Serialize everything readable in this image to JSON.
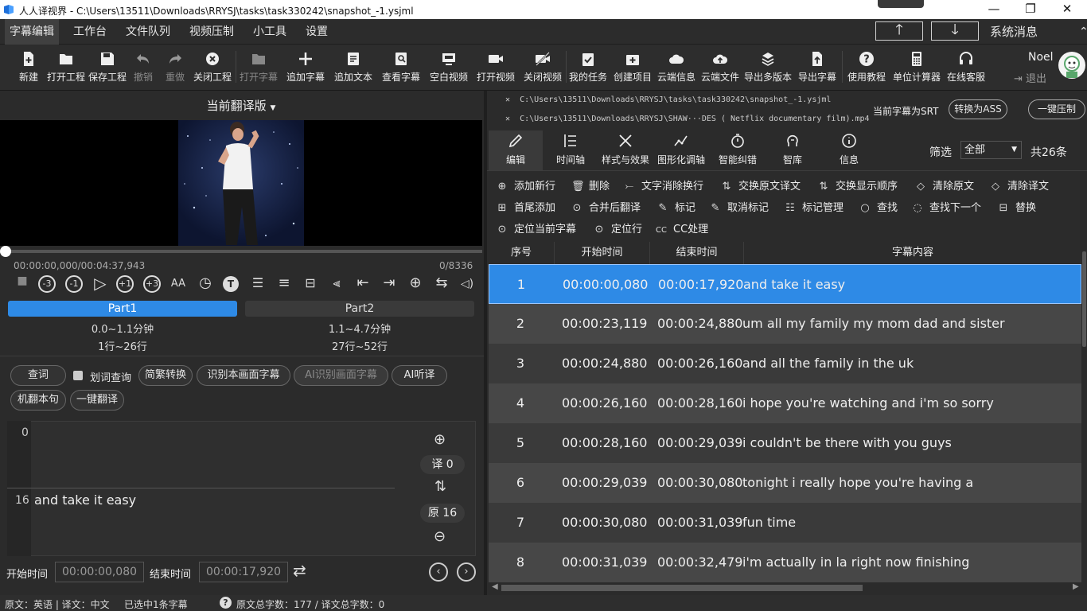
{
  "window": {
    "title": "人人译视界 - C:\\Users\\13511\\Downloads\\RRYSJ\\tasks\\task330242\\snapshot_-1.ysjml",
    "minimize_glyph": "—",
    "maximize_glyph": "❐",
    "close_glyph": "✕"
  },
  "menubar": {
    "items": [
      "字幕编辑",
      "工作台",
      "文件队列",
      "视频压制",
      "小工具",
      "设置"
    ],
    "up_glyph": "🡑",
    "down_glyph": "🡓",
    "system_messages": "系统消息"
  },
  "toolbar": {
    "items": [
      {
        "label": "新建",
        "icon": "new-file-icon"
      },
      {
        "label": "打开工程",
        "icon": "folder-open-icon"
      },
      {
        "label": "保存工程",
        "icon": "save-icon"
      },
      {
        "label": "撤销",
        "icon": "undo-icon"
      },
      {
        "label": "重做",
        "icon": "redo-icon"
      },
      {
        "label": "关闭工程",
        "icon": "close-circle-icon"
      },
      {
        "label": "打开字幕",
        "icon": "folder-icon"
      },
      {
        "label": "追加字幕",
        "icon": "plus-icon"
      },
      {
        "label": "追加文本",
        "icon": "text-doc-icon"
      },
      {
        "label": "查看字幕",
        "icon": "view-subtitle-icon"
      },
      {
        "label": "空白视频",
        "icon": "blank-video-icon"
      },
      {
        "label": "打开视频",
        "icon": "video-camera-icon"
      },
      {
        "label": "关闭视频",
        "icon": "video-off-icon"
      },
      {
        "label": "我的任务",
        "icon": "clipboard-check-icon"
      },
      {
        "label": "创建项目",
        "icon": "create-project-icon"
      },
      {
        "label": "云端信息",
        "icon": "cloud-icon"
      },
      {
        "label": "云端文件",
        "icon": "cloud-upload-icon"
      },
      {
        "label": "导出多版本",
        "icon": "layers-export-icon"
      },
      {
        "label": "导出字幕",
        "icon": "export-file-icon"
      },
      {
        "label": "使用教程",
        "icon": "help-icon"
      },
      {
        "label": "单位计算器",
        "icon": "calculator-icon"
      },
      {
        "label": "在线客服",
        "icon": "headset-icon"
      }
    ],
    "user_name": "Noel",
    "logout": "退出"
  },
  "left": {
    "version_select": "当前翻译版",
    "time_readout": "00:00:00,000/00:04:37,943",
    "frame_counter": "0/8336",
    "controls": [
      {
        "name": "stop-icon",
        "glyph": "■"
      },
      {
        "name": "rewind-3-icon",
        "glyph": "-3"
      },
      {
        "name": "rewind-1-icon",
        "glyph": "-1"
      },
      {
        "name": "play-icon",
        "glyph": "▷"
      },
      {
        "name": "forward-1-icon",
        "glyph": "+1"
      },
      {
        "name": "forward-3-icon",
        "glyph": "+3"
      },
      {
        "name": "font-size-icon",
        "glyph": "AA"
      },
      {
        "name": "clock-icon",
        "glyph": "◷"
      },
      {
        "name": "text-t-icon",
        "glyph": "T"
      },
      {
        "name": "align-icon",
        "glyph": "☰"
      },
      {
        "name": "align-center-icon",
        "glyph": "≡"
      },
      {
        "name": "align-middle-icon",
        "glyph": "⊟"
      },
      {
        "name": "align-left-bar-icon",
        "glyph": "⫷"
      },
      {
        "name": "to-start-icon",
        "glyph": "⇤"
      },
      {
        "name": "to-end-icon",
        "glyph": "⇥"
      },
      {
        "name": "target-icon",
        "glyph": "⊕"
      },
      {
        "name": "swap-icon",
        "glyph": "⇆"
      },
      {
        "name": "volume-icon",
        "glyph": "◁)"
      }
    ],
    "parts": [
      {
        "label": "Part1",
        "range_min": "0.0~1.1分钟",
        "range_rows": "1行~26行"
      },
      {
        "label": "Part2",
        "range_min": "1.1~4.7分钟",
        "range_rows": "27行~52行"
      }
    ],
    "actions": {
      "lookup": "查词",
      "select_lookup": "划词查询",
      "simp_trad": "简繁转换",
      "recognize_screen": "识别本画面字幕",
      "ai_recognize": "AI识别画面字幕",
      "ai_listen": "AI听译",
      "mt_sentence": "机翻本句",
      "one_click_translate": "一键翻译"
    },
    "editor": {
      "translation_count": "0",
      "original_count": "16",
      "original_text": "and take it easy",
      "trans_badge": "译 0",
      "orig_badge": "原 16"
    },
    "time_fields": {
      "start_label": "开始时间",
      "start_value": "00:00:00,080",
      "end_label": "结束时间",
      "end_value": "00:00:17,920"
    }
  },
  "right": {
    "files": [
      "C:\\Users\\13511\\Downloads\\RRYSJ\\tasks\\task330242\\snapshot_-1.ysjml",
      "C:\\Users\\13511\\Downloads\\RRYSJ\\SHAW···DES ( Netflix documentary film).mp4"
    ],
    "srt_status": "当前字幕为SRT",
    "convert_ass": "转换为ASS",
    "one_click_burn": "一键压制",
    "tabs": [
      {
        "label": "编辑",
        "icon": "pencil-icon"
      },
      {
        "label": "时间轴",
        "icon": "timeline-icon"
      },
      {
        "label": "样式与效果",
        "icon": "tools-icon"
      },
      {
        "label": "图形化调轴",
        "icon": "graph-icon"
      },
      {
        "label": "智能纠错",
        "icon": "stopwatch-icon"
      },
      {
        "label": "智库",
        "icon": "brain-icon"
      },
      {
        "label": "信息",
        "icon": "info-icon"
      }
    ],
    "filter_label": "筛选",
    "filter_value": "全部",
    "total": "共26条",
    "actions": [
      {
        "label": "添加新行",
        "glyph": "⊕"
      },
      {
        "label": "删除",
        "glyph": "🗑"
      },
      {
        "label": "文字消除换行",
        "glyph": "⤚"
      },
      {
        "label": "交换原文译文",
        "glyph": "⇅"
      },
      {
        "label": "交换显示顺序",
        "glyph": "⇅"
      },
      {
        "label": "清除原文",
        "glyph": "◇"
      },
      {
        "label": "清除译文",
        "glyph": "◇"
      },
      {
        "label": "首尾添加",
        "glyph": "⊞"
      },
      {
        "label": "合并后翻译",
        "glyph": "⊙"
      },
      {
        "label": "标记",
        "glyph": "✎"
      },
      {
        "label": "取消标记",
        "glyph": "✎"
      },
      {
        "label": "标记管理",
        "glyph": "☷"
      },
      {
        "label": "查找",
        "glyph": "○"
      },
      {
        "label": "查找下一个",
        "glyph": "◌"
      },
      {
        "label": "替换",
        "glyph": "⊟"
      },
      {
        "label": "定位当前字幕",
        "glyph": "⊙"
      },
      {
        "label": "定位行",
        "glyph": "⊙"
      },
      {
        "label": "CC处理",
        "glyph": "CC"
      }
    ],
    "table": {
      "headers": [
        "序号",
        "开始时间",
        "结束时间",
        "字幕内容"
      ],
      "rows": [
        [
          "1",
          "00:00:00,080",
          "00:00:17,920",
          "and take it easy"
        ],
        [
          "2",
          "00:00:23,119",
          "00:00:24,880",
          "um all my family my mom dad and sister"
        ],
        [
          "3",
          "00:00:24,880",
          "00:00:26,160",
          "and all the family in the uk"
        ],
        [
          "4",
          "00:00:26,160",
          "00:00:28,160",
          "i hope you're watching and i'm so sorry"
        ],
        [
          "5",
          "00:00:28,160",
          "00:00:29,039",
          "i couldn't be there with you guys"
        ],
        [
          "6",
          "00:00:29,039",
          "00:00:30,080",
          "tonight i really hope you're having a"
        ],
        [
          "7",
          "00:00:30,080",
          "00:00:31,039",
          "fun time"
        ],
        [
          "8",
          "00:00:31,039",
          "00:00:32,479",
          "i'm actually in la right now finishing"
        ]
      ]
    }
  },
  "statusbar": {
    "lang": "原文：英语 | 译文：中文",
    "selected": "已选中1条字幕",
    "counts": "原文总字数：177 / 译文总字数：0"
  },
  "colors": {
    "accent": "#2e8ae6",
    "bg": "#2b2b2b"
  }
}
